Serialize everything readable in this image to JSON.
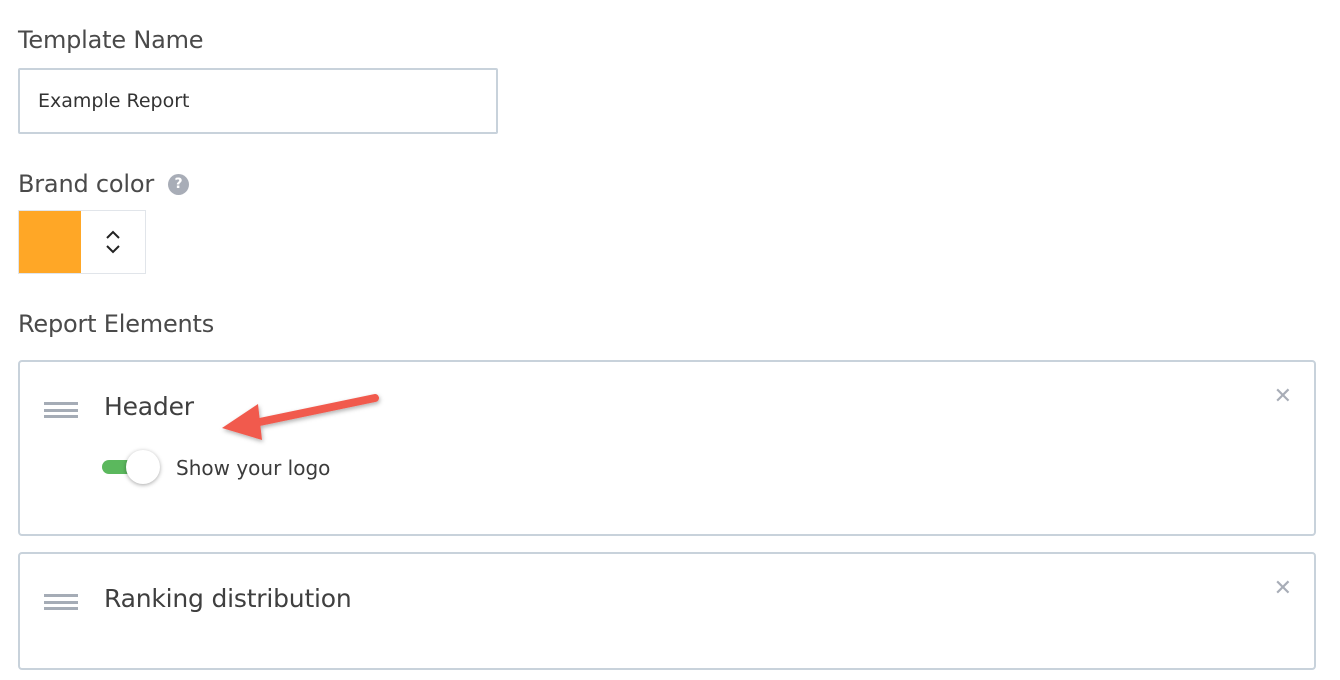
{
  "template_name": {
    "label": "Template Name",
    "value": "Example Report"
  },
  "brand_color": {
    "label": "Brand color",
    "help_icon": "question-mark-icon",
    "swatch_color": "#ffa726",
    "stepper_icon": "chevron-up-down-icon"
  },
  "report_elements": {
    "label": "Report Elements",
    "items": [
      {
        "title": "Header",
        "toggle_label": "Show your logo",
        "toggle_on": true,
        "toggle_color": "#5bb85d"
      },
      {
        "title": "Ranking distribution"
      }
    ],
    "remove_icon": "close-icon",
    "drag_icon": "drag-handle-icon"
  },
  "annotation": {
    "arrow_color": "#f15a4d"
  }
}
